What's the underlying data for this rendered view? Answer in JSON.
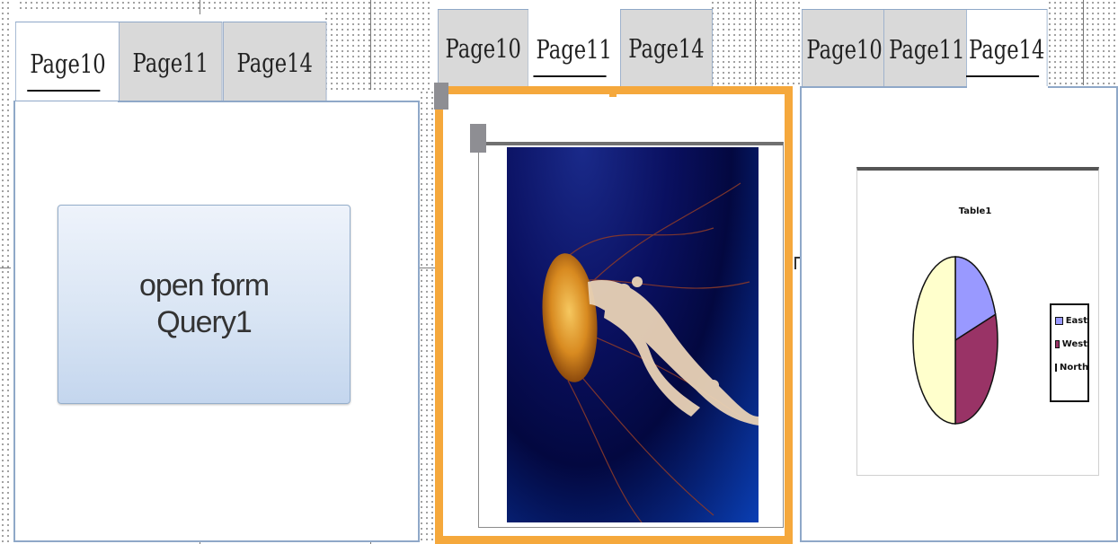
{
  "panels": [
    {
      "tabs": [
        "Page10",
        "Page11",
        "Page14"
      ],
      "active_tab": 0,
      "button": {
        "line1": "open form",
        "line2": "Query1"
      }
    },
    {
      "tabs": [
        "Page10",
        "Page11",
        "Page14"
      ],
      "active_tab": 1,
      "image": {
        "subject": "jellyfish"
      }
    },
    {
      "tabs": [
        "Page10",
        "Page11",
        "Page14"
      ],
      "active_tab": 2,
      "chart": {
        "title": "Table1"
      }
    }
  ],
  "chart_data": {
    "type": "pie",
    "title": "Table1",
    "labels": [
      "East",
      "West",
      "North"
    ],
    "values": [
      20,
      30,
      50
    ],
    "colors": [
      "#9999ff",
      "#993366",
      "#ffffcc"
    ],
    "legend": "right"
  },
  "colors": {
    "tab_border": "#8fa8c8",
    "selection": "#f5a83c",
    "inactive_tab": "#d9d9d9"
  }
}
